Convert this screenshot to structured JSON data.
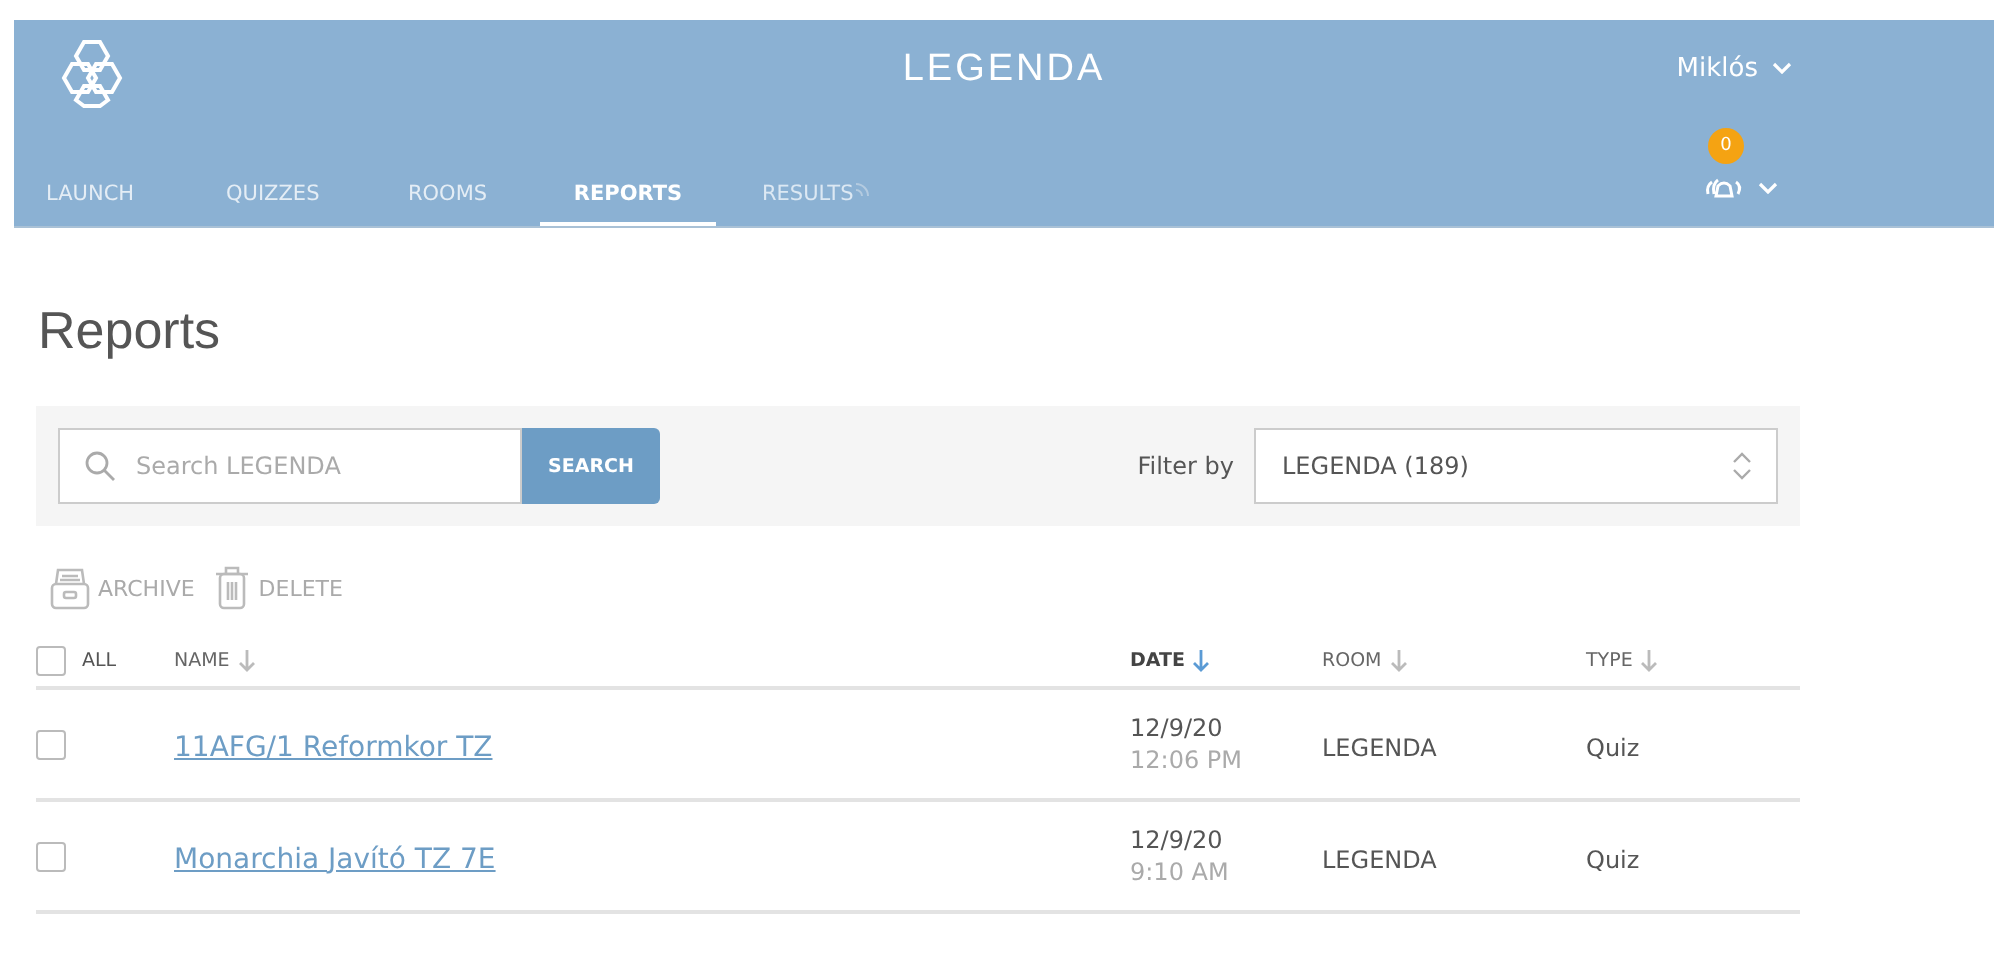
{
  "header": {
    "title": "LEGENDA",
    "user": "Miklós",
    "notification_count": "0"
  },
  "tabs": [
    {
      "label": "LAUNCH",
      "selected": false,
      "disabled": false
    },
    {
      "label": "QUIZZES",
      "selected": false,
      "disabled": false
    },
    {
      "label": "ROOMS",
      "selected": false,
      "disabled": false
    },
    {
      "label": "REPORTS",
      "selected": true,
      "disabled": false
    },
    {
      "label": "RESULTS",
      "selected": false,
      "disabled": true
    }
  ],
  "page_title": "Reports",
  "search": {
    "placeholder": "Search LEGENDA",
    "button": "SEARCH"
  },
  "filter": {
    "label": "Filter by",
    "value": "LEGENDA (189)"
  },
  "actions": [
    {
      "kind": "archive",
      "label": "ARCHIVE"
    },
    {
      "kind": "delete",
      "label": "DELETE"
    }
  ],
  "table": {
    "select_all": {
      "label": "ALL",
      "checked": false
    },
    "columns": [
      {
        "label": "NAME",
        "sorted": false
      },
      {
        "label": "DATE",
        "sorted": true
      },
      {
        "label": "ROOM",
        "sorted": false
      },
      {
        "label": "TYPE",
        "sorted": false
      }
    ],
    "rows": [
      {
        "checked": false,
        "name": "11AFG/1 Reformkor TZ",
        "date": "12/9/20",
        "time": "12:06 PM",
        "room": "LEGENDA",
        "type": "Quiz"
      },
      {
        "checked": false,
        "name": "Monarchia Javító TZ 7E",
        "date": "12/9/20",
        "time": "9:10 AM",
        "room": "LEGENDA",
        "type": "Quiz"
      }
    ]
  }
}
